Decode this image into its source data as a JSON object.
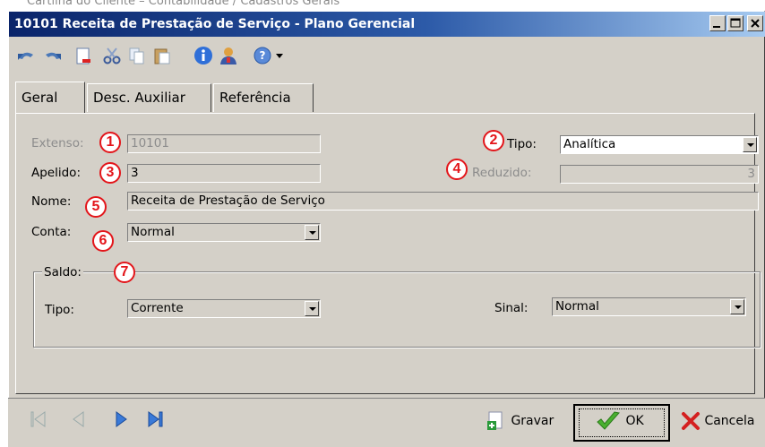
{
  "page_caption": "Cartilha do Cliente – Contabilidade / Cadastros Gerais",
  "window": {
    "title": "10101 Receita de Prestação de Serviço - Plano Gerencial",
    "buttons": [
      "minimize",
      "maximize",
      "close"
    ]
  },
  "toolbar": {
    "icons": [
      "undo-icon",
      "redo-icon",
      "new-document-icon",
      "cut-icon",
      "copy-icon",
      "paste-icon",
      "info-icon",
      "user-icon",
      "help-icon",
      "dropdown-arrow-icon"
    ]
  },
  "tabs": [
    {
      "label": "Geral",
      "active": true
    },
    {
      "label": "Desc. Auxiliar",
      "active": false
    },
    {
      "label": "Referência",
      "active": false
    }
  ],
  "form": {
    "extenso": {
      "label": "Extenso:",
      "value": "10101"
    },
    "tipo": {
      "label": "Tipo:",
      "value": "Analítica"
    },
    "apelido": {
      "label": "Apelido:",
      "value": "3"
    },
    "reduzido": {
      "label": "Reduzido:",
      "value": "3"
    },
    "nome": {
      "label": "Nome:",
      "value": "Receita de Prestação de Serviço"
    },
    "conta": {
      "label": "Conta:",
      "value": "Normal"
    }
  },
  "saldo": {
    "title": "Saldo:",
    "tipo": {
      "label": "Tipo:",
      "value": "Corrente"
    },
    "sinal": {
      "label": "Sinal:",
      "value": "Normal"
    }
  },
  "markers": [
    "1",
    "2",
    "3",
    "4",
    "5",
    "6",
    "7"
  ],
  "bottom": {
    "gravar": "Gravar",
    "ok": "OK",
    "cancela": "Cancela"
  },
  "colors": {
    "titlebar_start": "#0a246a",
    "titlebar_end": "#a6caf0",
    "window_face": "#d4d0c8",
    "marker_red": "#e3151a"
  }
}
